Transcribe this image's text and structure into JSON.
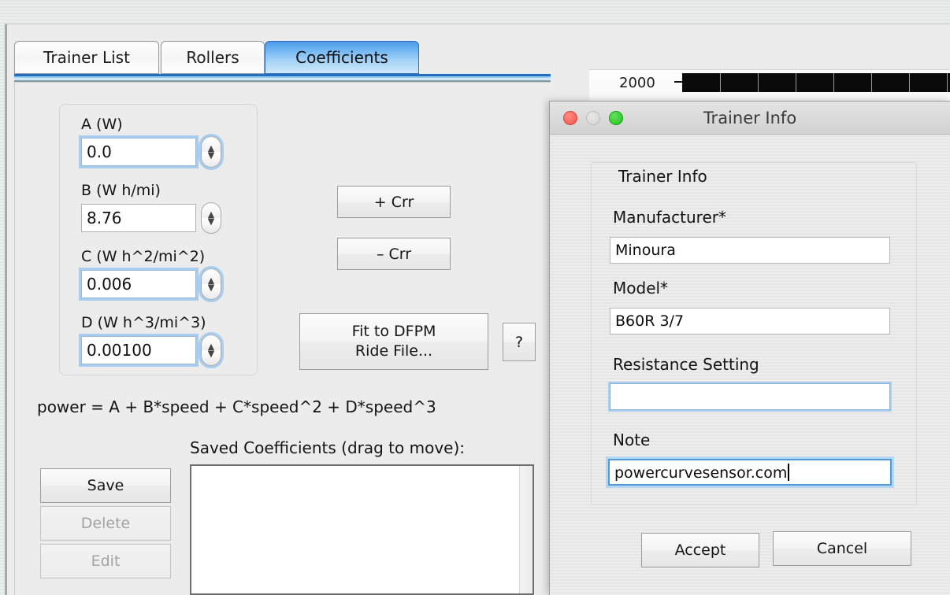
{
  "background_chart": {
    "ytick_label": "2000",
    "tick_mark": "−"
  },
  "main_window": {
    "tabs": [
      {
        "label": "Trainer List",
        "selected": false
      },
      {
        "label": "Rollers",
        "selected": false
      },
      {
        "label": "Coefficients",
        "selected": true
      }
    ],
    "coefficients": {
      "fields": [
        {
          "label": "A (W)",
          "value": "0.0",
          "focused": true
        },
        {
          "label": "B (W h/mi)",
          "value": "8.76",
          "focused": false
        },
        {
          "label": "C (W h^2/mi^2)",
          "value": "0.006",
          "focused": true
        },
        {
          "label": "D (W h^3/mi^3)",
          "value": "0.00100",
          "focused": true
        }
      ],
      "crr_plus_label": "+ Crr",
      "crr_minus_label": "– Crr",
      "fit_button_line1": "Fit to DFPM",
      "fit_button_line2": "Ride File...",
      "help_label": "?",
      "equation": "power = A + B*speed + C*speed^2 + D*speed^3",
      "saved_title": "Saved Coefficients (drag to move):",
      "save_label": "Save",
      "delete_label": "Delete",
      "edit_label": "Edit",
      "saved_items": []
    }
  },
  "dialog": {
    "title": "Trainer Info",
    "group_title": "Trainer Info",
    "fields": [
      {
        "label": "Manufacturer*",
        "value": "Minoura",
        "focus": "none"
      },
      {
        "label": "Model*",
        "value": "B60R 3/7",
        "focus": "none"
      },
      {
        "label": "Resistance Setting",
        "value": "",
        "focus": "ring"
      },
      {
        "label": "Note",
        "value": "powercurvesensor.com",
        "focus": "ring-strong"
      }
    ],
    "accept_label": "Accept",
    "cancel_label": "Cancel",
    "window_buttons": {
      "close": "close-button",
      "minimize": "minimize-button",
      "maximize": "maximize-button"
    }
  },
  "colors": {
    "accent_blue": "#4c9ae8",
    "focus_ring": "#a9cdee",
    "panel_bg": "#ececec"
  }
}
